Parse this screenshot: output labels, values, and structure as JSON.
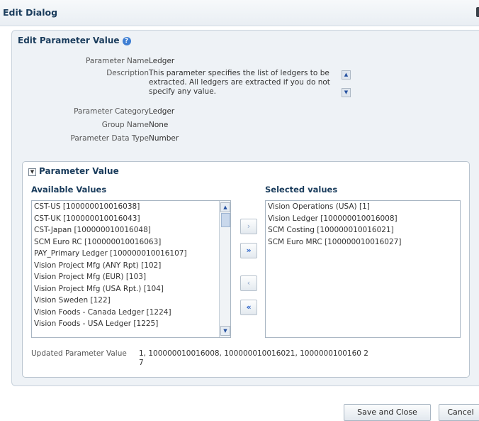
{
  "dialog": {
    "title": "Edit Dialog"
  },
  "section": {
    "title": "Edit Parameter Value",
    "help_icon": "?"
  },
  "fields": {
    "name_label": "Parameter Name",
    "name_value": "Ledger",
    "description_label": "Description",
    "description_value": "This parameter specifies the list of ledgers to be extracted. All ledgers are extracted if you do not specify any value.",
    "category_label": "Parameter Category",
    "category_value": "Ledger",
    "group_label": "Group Name",
    "group_value": "None",
    "datatype_label": "Parameter Data Type",
    "datatype_value": "Number"
  },
  "param_value": {
    "title": "Parameter Value",
    "available_label": "Available Values",
    "selected_label": "Selected values",
    "available_items": [
      "CST-US [100000010016038]",
      "CST-UK [100000010016043]",
      "CST-Japan [100000010016048]",
      "SCM Euro RC [100000010016063]",
      "PAY_Primary Ledger [100000010016107]",
      "Vision Project Mfg (ANY Rpt) [102]",
      "Vision Project Mfg (EUR) [103]",
      "Vision Project Mfg (USA Rpt.) [104]",
      "Vision Sweden [122]",
      "Vision Foods - Canada Ledger [1224]",
      "Vision Foods - USA Ledger [1225]"
    ],
    "selected_items": [
      "Vision Operations (USA) [1]",
      "Vision Ledger [100000010016008]",
      "SCM Costing [100000010016021]",
      "SCM Euro MRC [100000010016027]"
    ],
    "buttons": {
      "move": "›",
      "move_all": "»",
      "remove": "‹",
      "remove_all": "«"
    },
    "updated_label": "Updated Parameter Value",
    "updated_value": "1, 100000010016008, 100000010016021, 1000000100160 27"
  },
  "footer": {
    "save_close": "Save and Close",
    "cancel": "Cancel"
  }
}
